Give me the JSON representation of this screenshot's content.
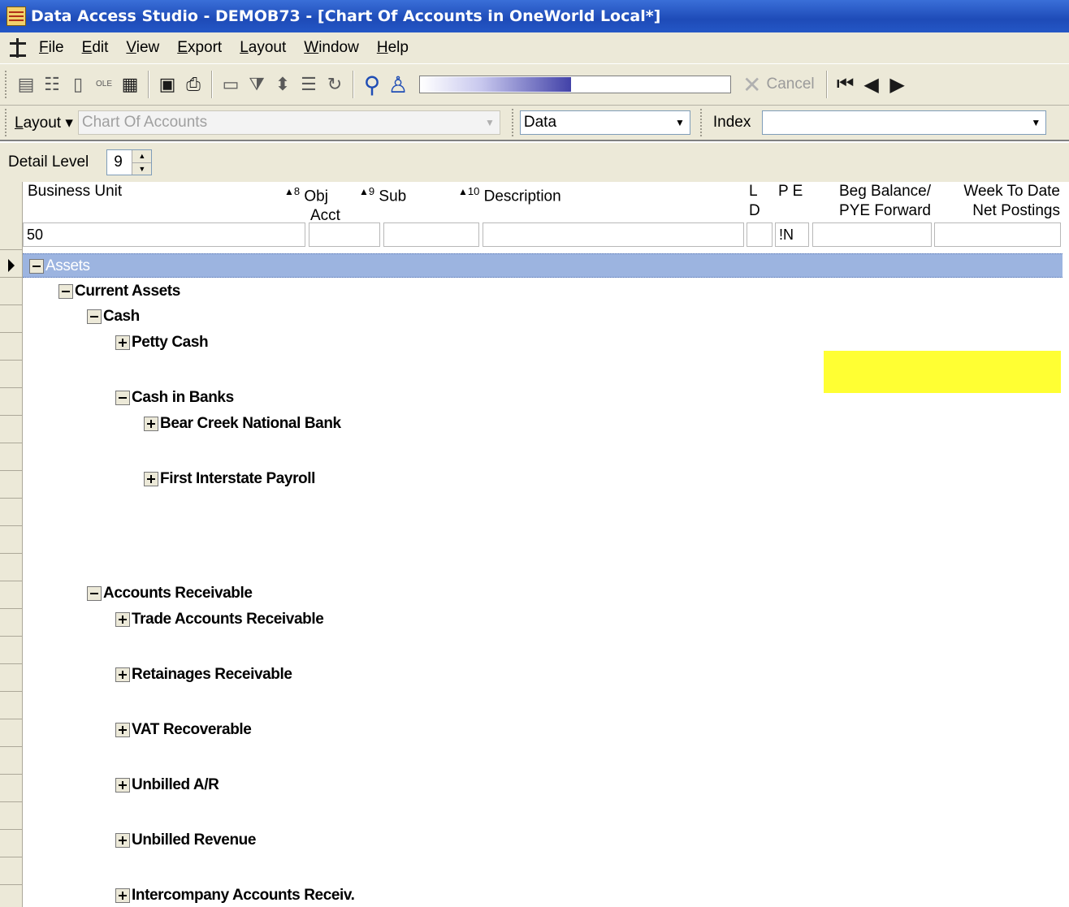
{
  "window": {
    "title": "Data Access Studio - DEMOB73 - [Chart Of Accounts in OneWorld Local*]"
  },
  "menu": [
    {
      "label": "File",
      "key": "F",
      "rest": "ile"
    },
    {
      "label": "Edit",
      "key": "E",
      "rest": "dit"
    },
    {
      "label": "View",
      "key": "V",
      "rest": "iew"
    },
    {
      "label": "Export",
      "key": "E",
      "rest": "xport"
    },
    {
      "label": "Layout",
      "key": "L",
      "rest": "ayout"
    },
    {
      "label": "Window",
      "key": "W",
      "rest": "indow"
    },
    {
      "label": "Help",
      "key": "H",
      "rest": "elp"
    }
  ],
  "toolbar": {
    "ole_label": "OLE",
    "cancel_label": "Cancel",
    "progress": 0.485
  },
  "layoutbar": {
    "layout_label": "Layout",
    "layout_value": "Chart Of Accounts",
    "data_value": "Data",
    "index_label": "Index",
    "index_value": ""
  },
  "detail": {
    "label": "Detail Level",
    "value": "9"
  },
  "columns": {
    "business_unit": "Business Unit",
    "obj_sort": "8",
    "obj_l1": "Obj",
    "obj_l2": "Acct",
    "sub_sort": "9",
    "sub_l1": "Sub",
    "desc_sort": "10",
    "desc_l1": "Description",
    "ld_l1": "L",
    "ld_l2": "D",
    "pe_l1": "P E",
    "beg_l1": "Beg Balance/",
    "beg_l2": "PYE Forward",
    "wtd_l1": "Week To Date",
    "wtd_l2": "Net Postings"
  },
  "filters": {
    "business_unit": "50",
    "obj": "",
    "sub": "",
    "description": "",
    "ld": "",
    "pe": "!N",
    "beg": "",
    "wtd": ""
  },
  "tree": {
    "assets": "Assets",
    "current_assets": "Current Assets",
    "cash": "Cash",
    "petty_cash": "Petty Cash",
    "cash_in_banks": "Cash in Banks",
    "bear_creek": "Bear Creek National Bank",
    "first_interstate": "First Interstate Payroll",
    "accounts_receivable": "Accounts Receivable",
    "trade_ar": "Trade Accounts Receivable",
    "retainages": "Retainages Receivable",
    "vat": "VAT Recoverable",
    "unbilled_ar": "Unbilled A/R",
    "unbilled_rev": "Unbilled Revenue",
    "intercompany": "Intercompany Accounts Receiv."
  },
  "colors": {
    "selection": "#9cb4e0",
    "highlight": "#ffff33",
    "titlebar": "#1e4bb8"
  }
}
